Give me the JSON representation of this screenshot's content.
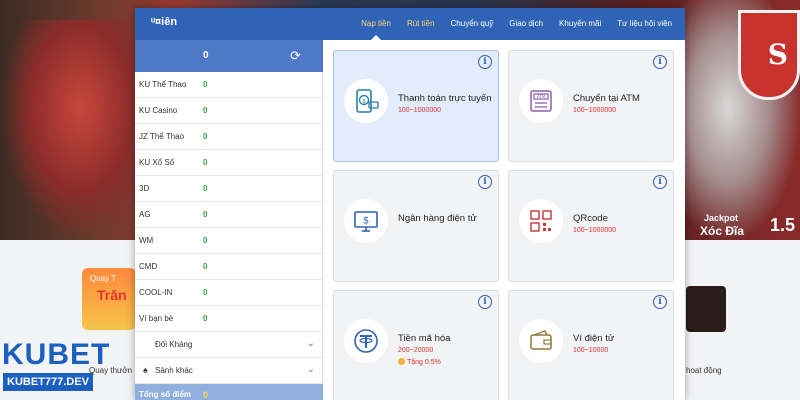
{
  "background": {
    "promo_quay": "Quay T",
    "promo_tran": "Trăn",
    "kubet": "KUBET",
    "kubet_domain": "KUBET777.DEV",
    "quay_thuong": "Quay thưởn",
    "jackpot": "Jackpot",
    "xoc_dia": "Xóc Đĩa",
    "jackpot_num": "1.5",
    "hoat_dong": "hoạt động"
  },
  "modal": {
    "brand": "ᵘ¤iên",
    "tabs": [
      {
        "label": "Nạp tiền",
        "active": true
      },
      {
        "label": "Rút tiền"
      },
      {
        "label": "Chuyển quỹ"
      },
      {
        "label": "Giao dịch"
      },
      {
        "label": "Khuyến mãi"
      },
      {
        "label": "Tư liệu hội viên"
      }
    ],
    "wallet_value": "0",
    "accounts": [
      {
        "name": "KU Thể Thao",
        "value": "0"
      },
      {
        "name": "KU Casino",
        "value": "0"
      },
      {
        "name": "JZ Thể Thao",
        "value": "0"
      },
      {
        "name": "KU Xổ Số",
        "value": "0"
      },
      {
        "name": "3D",
        "value": "0"
      },
      {
        "name": "AG",
        "value": "0"
      },
      {
        "name": "WM",
        "value": "0"
      },
      {
        "name": "CMD",
        "value": "0"
      },
      {
        "name": "COOL-IN",
        "value": "0"
      },
      {
        "name": "Ví bạn bè",
        "value": "0"
      }
    ],
    "expand_1": "Đối Kháng",
    "expand_2": "Sảnh khác",
    "total_label": "Tổng số điểm",
    "total_value": "0",
    "payments": [
      {
        "title": "Thanh toán trực tuyến",
        "range": "100~1000000",
        "icon": "mobile-payment-icon",
        "selected": true
      },
      {
        "title": "Chuyển tại ATM",
        "range": "100~1000000",
        "icon": "atm-icon"
      },
      {
        "title": "Ngân hàng điện tử",
        "range": "",
        "icon": "online-banking-icon"
      },
      {
        "title": "QRcode",
        "range": "100~1000000",
        "icon": "qr-code-icon"
      },
      {
        "title": "Tiền mã hóa",
        "range": "200~20000",
        "bonus": "Tặng 0.5%",
        "icon": "tether-icon"
      },
      {
        "title": "Ví điện tử",
        "range": "100~10000",
        "icon": "e-wallet-icon"
      }
    ],
    "colors": {
      "primary": "#2f63b5",
      "positive": "#2fa34a",
      "range": "#d9332f"
    }
  }
}
